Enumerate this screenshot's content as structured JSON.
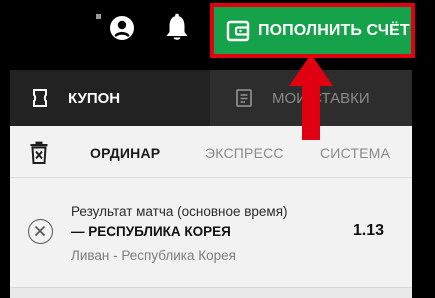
{
  "header": {
    "deposit_button_label": "ПОПОЛНИТЬ СЧЁТ",
    "icons": [
      "user-icon",
      "bell-icon",
      "wallet-icon"
    ]
  },
  "coupon": {
    "tabs": [
      {
        "label": "КУПОН",
        "icon": "coupon-icon",
        "active": true
      },
      {
        "label": "МОИ СТАВКИ",
        "icon": "bets-icon",
        "active": false
      }
    ],
    "bet_types": [
      {
        "label": "ОРДИНАР",
        "active": true
      },
      {
        "label": "ЭКСПРЕСС",
        "active": false
      },
      {
        "label": "СИСТЕМА",
        "active": false
      }
    ],
    "selection": {
      "market": "Результат матча (основное время)",
      "outcome": "— РЕСПУБЛИКА КОРЕЯ",
      "odds": "1.13",
      "event": "Ливан - Республика Корея"
    }
  },
  "colors": {
    "deposit_green": "#15a24a",
    "annotation_red": "#e10012",
    "active_tab": "#222222",
    "panel_bg": "#f2f2f2"
  }
}
